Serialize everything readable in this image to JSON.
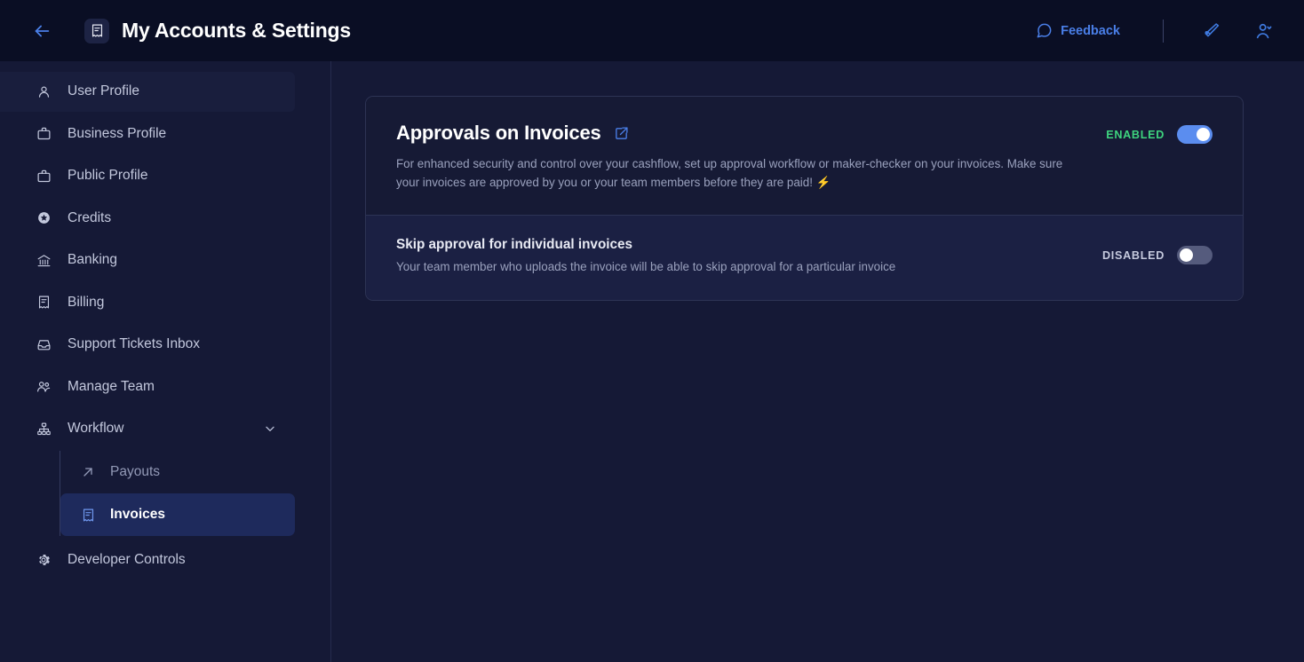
{
  "header": {
    "back_icon": "arrow-left-icon",
    "title_icon": "receipt-icon",
    "title": "My Accounts & Settings",
    "feedback_label": "Feedback",
    "feedback_icon": "chat-bubble-icon",
    "announce_icon": "megaphone-icon",
    "account_icon": "user-chevron-icon",
    "accent": "#4a7fe8",
    "background": "#0a0e24"
  },
  "sidebar": {
    "items": [
      {
        "label": "User Profile",
        "icon": "user-icon",
        "hovered": true
      },
      {
        "label": "Business Profile",
        "icon": "briefcase-icon",
        "hovered": false
      },
      {
        "label": "Public Profile",
        "icon": "briefcase-icon",
        "hovered": false
      },
      {
        "label": "Credits",
        "icon": "star-circle-icon",
        "hovered": false
      },
      {
        "label": "Banking",
        "icon": "bank-icon",
        "hovered": false
      },
      {
        "label": "Billing",
        "icon": "receipt-icon",
        "hovered": false
      },
      {
        "label": "Support Tickets Inbox",
        "icon": "inbox-icon",
        "hovered": false
      },
      {
        "label": "Manage Team",
        "icon": "users-icon",
        "hovered": false
      }
    ],
    "workflow": {
      "label": "Workflow",
      "icon": "sitemap-icon",
      "chevron": "chevron-down-icon",
      "expanded": true,
      "children": [
        {
          "label": "Payouts",
          "icon": "arrow-up-right-icon",
          "active": false
        },
        {
          "label": "Invoices",
          "icon": "receipt-icon",
          "active": true
        }
      ]
    },
    "footer_item": {
      "label": "Developer Controls",
      "icon": "gear-icon"
    }
  },
  "main": {
    "approvals": {
      "title": "Approvals on Invoices",
      "external_link_icon": "external-link-icon",
      "description": "For enhanced security and control over your cashflow, set up approval workflow or maker-checker on your invoices. Make sure your invoices are approved by you or your team members before they are paid! ⚡",
      "toggle_label": "ENABLED",
      "toggle_state": "on",
      "toggle_color": "#3ed47e"
    },
    "skip_approval": {
      "title": "Skip approval for individual invoices",
      "description": "Your team member who uploads the invoice will be able to skip approval for a particular invoice",
      "toggle_label": "DISABLED",
      "toggle_state": "off",
      "toggle_color": "#c6cade"
    }
  }
}
